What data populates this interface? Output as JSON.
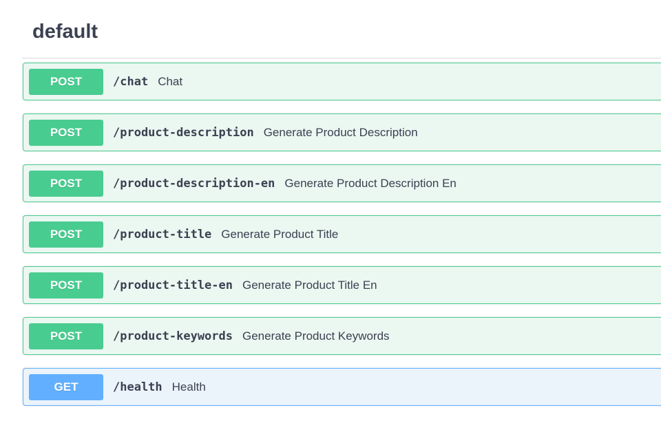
{
  "section": {
    "title": "default"
  },
  "operations": [
    {
      "method": "POST",
      "path": "/chat",
      "summary": "Chat"
    },
    {
      "method": "POST",
      "path": "/product-description",
      "summary": "Generate Product Description"
    },
    {
      "method": "POST",
      "path": "/product-description-en",
      "summary": "Generate Product Description En"
    },
    {
      "method": "POST",
      "path": "/product-title",
      "summary": "Generate Product Title"
    },
    {
      "method": "POST",
      "path": "/product-title-en",
      "summary": "Generate Product Title En"
    },
    {
      "method": "POST",
      "path": "/product-keywords",
      "summary": "Generate Product Keywords"
    },
    {
      "method": "GET",
      "path": "/health",
      "summary": "Health"
    }
  ],
  "colors": {
    "post": "#49cc90",
    "post_bg": "#ebf7f1",
    "get": "#61affe",
    "get_bg": "#ebf3fb",
    "text": "#3b4151"
  }
}
